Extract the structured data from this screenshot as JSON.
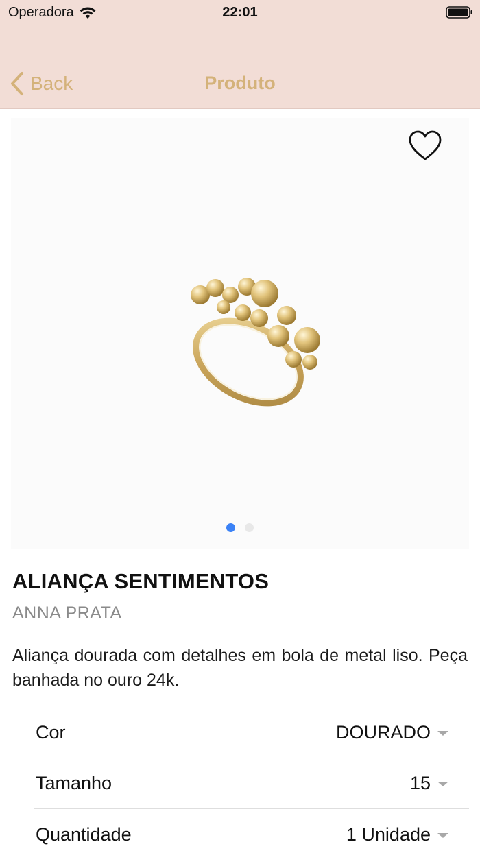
{
  "status_bar": {
    "carrier": "Operadora",
    "time": "22:01",
    "icons": [
      "wifi-icon",
      "battery-icon"
    ]
  },
  "nav": {
    "back_label": "Back",
    "title": "Produto",
    "accent_color": "#d4b27a",
    "background_color": "#f2ddd6"
  },
  "gallery": {
    "favorite_icon": "heart-outline-icon",
    "image": "gold-ring-with-beads",
    "page_count": 2,
    "current_page": 1,
    "active_dot_color": "#3b82f6"
  },
  "product": {
    "name": "ALIANÇA SENTIMENTOS",
    "brand": "ANNA PRATA",
    "description": "Aliança dourada com detalhes em bola de metal liso. Peça banhada no ouro 24k."
  },
  "options": [
    {
      "label": "Cor",
      "value": "DOURADO"
    },
    {
      "label": "Tamanho",
      "value": "15"
    },
    {
      "label": "Quantidade",
      "value": "1 Unidade"
    }
  ]
}
